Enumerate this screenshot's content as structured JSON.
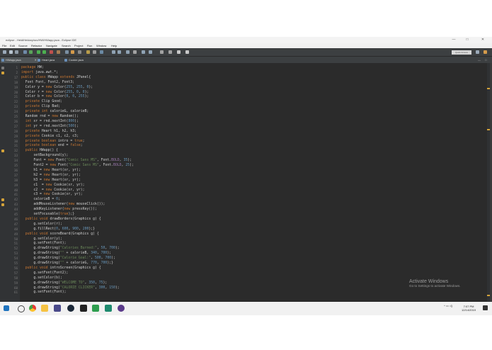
{
  "window": {
    "title": "eclipse - HeidiHeidary/src/HW/HWapp.java - Eclipse IDE",
    "controls": [
      "—",
      "□",
      "✕"
    ]
  },
  "menu": [
    "File",
    "Edit",
    "Source",
    "Refactor",
    "Navigate",
    "Search",
    "Project",
    "Run",
    "Window",
    "Help"
  ],
  "toolbar": {
    "quick_access": "Quick Access"
  },
  "tabs": [
    {
      "label": "HWapp.java",
      "active": true
    },
    {
      "label": "Heart.java",
      "active": false
    },
    {
      "label": "Cookie.java",
      "active": false
    }
  ],
  "editor": {
    "line_numbers": [
      "1",
      "2",
      "17",
      "18",
      "19",
      "20",
      "21",
      "22",
      "23",
      "24",
      "25",
      "26",
      "27",
      "28",
      "29",
      "30",
      "31",
      "32",
      "33",
      "34",
      "35",
      "36",
      "37",
      "38",
      "39",
      "40",
      "41",
      "42",
      "43",
      "44",
      "45",
      "46",
      "47",
      "48",
      "49",
      "50",
      "51",
      "52",
      "53",
      "54",
      "55",
      "56",
      "57",
      "58",
      "59",
      "60",
      "61"
    ],
    "code": [
      "package HW;",
      "import java.awt.*;",
      "public class HWapp extends JPanel{",
      "  Font Font, Font2, Font3;",
      "  Color y = new Color(255, 255, 0);",
      "  Color r = new Color(255, 0, 0);",
      "  Color b = new Color(0, 0, 255);",
      "  private Clip Good;",
      "  private Clip Bad;",
      "  private int calorieG, calorieB;",
      "  Random rnd = new Random();",
      "  int xr = rnd.nextInt(800);",
      "  int yr = rnd.nextInt(500);",
      "  private Heart h1, h2, h3;",
      "  private Cookie c1, c2, c3;",
      "  private boolean intro = true;",
      "  private boolean end = false;",
      "  public HWapp() {",
      "      setBackground(y);",
      "      Font = new Font(\"Comic Sans MS\", Font.BOLD, 35);",
      "      Font2 = new Font(\"Comic Sans MS\", Font.BOLD, 25);",
      "      h1 = new Heart(xr, yr);",
      "      h2 = new Heart(xr, yr);",
      "      h3 = new Heart(xr, yr);",
      "      c1  = new Cookie(xr, yr);",
      "      c2  = new Cookie(xr, yr);",
      "      c3 = new Cookie(xr, yr);",
      "      calorieB = 0;",
      "      addMouseListener(new mouseClick());",
      "      addKeyListener(new pressKey());",
      "      setFocusable(true);}",
      "  public void drawBorders(Graphics g) {",
      "      g.setColor(r);",
      "      g.fillRect(0, 600, 900, 200);}",
      "  public void scoreBoard(Graphics g) {",
      "      g.setColor(y);",
      "      g.setFont(Font);",
      "      g.drawString(\"Calories Burned:\", 50, 700);",
      "      g.drawString(\"\" + calorieB, 340, 700);",
      "      g.drawString(\"Calorie Goal:\", 500, 700);",
      "      g.drawString(\"\" + calorieG, 770, 700);}",
      "  public void introScreen(Graphics g) {",
      "      g.setFont(Font2);",
      "      g.setColor(b);",
      "      g.drawString(\"WELCOME TO\", 350, 75);",
      "      g.drawString(\"CALORIE CLICKER\", 300, 150);",
      "      g.setFont(Font);"
    ]
  },
  "status": {
    "writable": "Writable",
    "insert": "Smart Insert",
    "position": "141 : 117"
  },
  "watermark": {
    "line1": "Activate Windows",
    "line2": "Go to Settings to activate Windows."
  },
  "taskbar": {
    "time": "7:07 PM",
    "date": "12/14/2019"
  },
  "colors": {
    "editor_bg": "#2b2b2b",
    "keyword": "#cc7832",
    "string": "#6a8759",
    "number": "#6897bb",
    "field": "#9876aa"
  }
}
